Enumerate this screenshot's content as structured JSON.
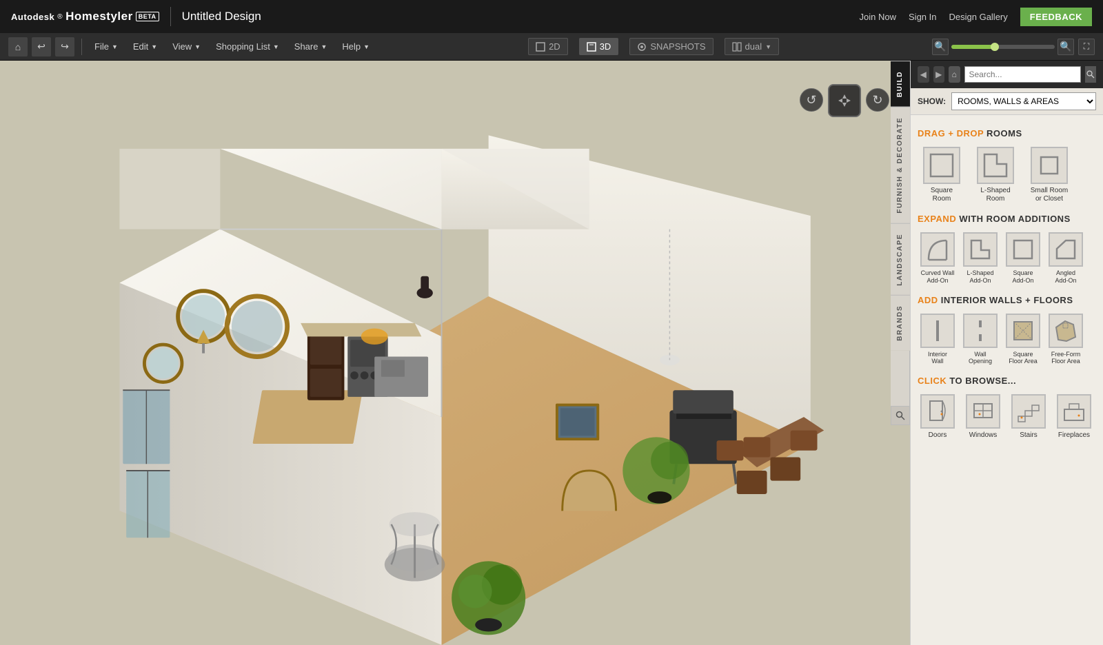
{
  "app": {
    "brand": "Autodesk",
    "name": "Homestyler",
    "beta": "BETA",
    "title": "Untitled Design"
  },
  "topbar": {
    "join_now": "Join Now",
    "sign_in": "Sign In",
    "design_gallery": "Design Gallery",
    "feedback": "FEEDBACK"
  },
  "toolbar": {
    "file": "File",
    "edit": "Edit",
    "view": "View",
    "shopping_list": "Shopping List",
    "share": "Share",
    "help": "Help",
    "btn_2d": "2D",
    "btn_3d": "3D",
    "snapshots": "SNAPSHOTS",
    "dual": "dual"
  },
  "panel": {
    "show_label": "SHOW:",
    "show_option": "ROOMS, WALLS & AREAS",
    "build_tab": "BUILD",
    "furnish_tab": "FURNISH & DECORATE",
    "landscape_tab": "LANDSCAPE",
    "brands_tab": "BRANDS"
  },
  "rooms": {
    "header_highlight": "DRAG + DROP",
    "header_normal": " ROOMS",
    "items": [
      {
        "label": "Square\nRoom",
        "id": "square-room"
      },
      {
        "label": "L-Shaped\nRoom",
        "id": "l-shaped-room"
      },
      {
        "label": "Small Room\nor Closet",
        "id": "small-room"
      }
    ]
  },
  "addons": {
    "header_highlight": "EXPAND",
    "header_normal": " WITH ROOM ADDITIONS",
    "items": [
      {
        "label": "Curved Wall\nAdd-On",
        "id": "curved-wall"
      },
      {
        "label": "L-Shaped\nAdd-On",
        "id": "l-shaped-addon"
      },
      {
        "label": "Square\nAdd-On",
        "id": "square-addon"
      },
      {
        "label": "Angled\nAdd-On",
        "id": "angled-addon"
      }
    ]
  },
  "walls": {
    "header_highlight": "ADD",
    "header_normal": " INTERIOR WALLS + FLOORS",
    "items": [
      {
        "label": "Interior\nWall",
        "id": "interior-wall"
      },
      {
        "label": "Wall\nOpening",
        "id": "wall-opening"
      },
      {
        "label": "Square\nFloor Area",
        "id": "square-floor"
      },
      {
        "label": "Free-Form\nFloor Area",
        "id": "freeform-floor"
      }
    ]
  },
  "browse": {
    "header_highlight": "CLICK",
    "header_normal": " TO BROWSE...",
    "items": [
      {
        "label": "Doors",
        "id": "doors"
      },
      {
        "label": "Windows",
        "id": "windows"
      },
      {
        "label": "Stairs",
        "id": "stairs"
      },
      {
        "label": "Fireplaces",
        "id": "fireplaces"
      }
    ]
  }
}
